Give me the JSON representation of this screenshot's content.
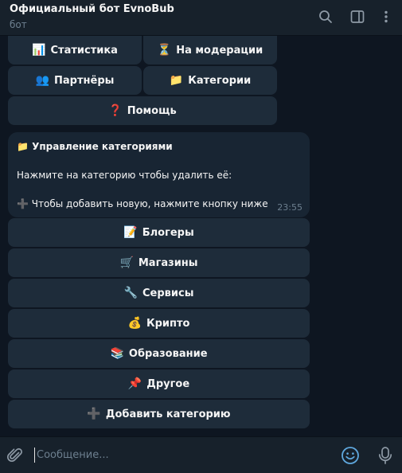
{
  "header": {
    "title": "Официальный бот EvnoBub",
    "subtitle": "бот",
    "icons": [
      "search-icon",
      "sidebar-toggle-icon",
      "more-vertical-icon"
    ]
  },
  "top_keyboard": {
    "stats": {
      "emoji": "📊",
      "label": "Статистика"
    },
    "moderation": {
      "emoji": "⏳",
      "label": "На модерации"
    },
    "partners": {
      "emoji": "👥",
      "label": "Партнёры"
    },
    "categories": {
      "emoji": "📁",
      "label": "Категории"
    },
    "help": {
      "emoji": "❓",
      "label": "Помощь"
    }
  },
  "message": {
    "title_emoji": "📁",
    "title": "Управление категориями",
    "instruction": "Нажмите на категорию чтобы удалить её:",
    "hint_emoji": "➕",
    "hint": "Чтобы добавить новую, нажмите кнопку ниже",
    "time": "23:55"
  },
  "inline_keyboard": [
    {
      "emoji": "📝",
      "label": "Блогеры"
    },
    {
      "emoji": "🛒",
      "label": "Магазины"
    },
    {
      "emoji": "🔧",
      "label": "Сервисы"
    },
    {
      "emoji": "💰",
      "label": "Крипто"
    },
    {
      "emoji": "📚",
      "label": "Образование"
    },
    {
      "emoji": "📌",
      "label": "Другое"
    },
    {
      "emoji": "➕",
      "label": "Добавить категорию"
    }
  ],
  "composer": {
    "placeholder": "Сообщение...",
    "icons": [
      "attach-icon",
      "emoji-icon",
      "microphone-icon"
    ]
  },
  "colors": {
    "background": "#0e1621",
    "panel": "#17212b",
    "button": "#1e2c3a",
    "bubble": "#182533",
    "accent": "#5fa8de",
    "muted": "#6d7f8f"
  }
}
